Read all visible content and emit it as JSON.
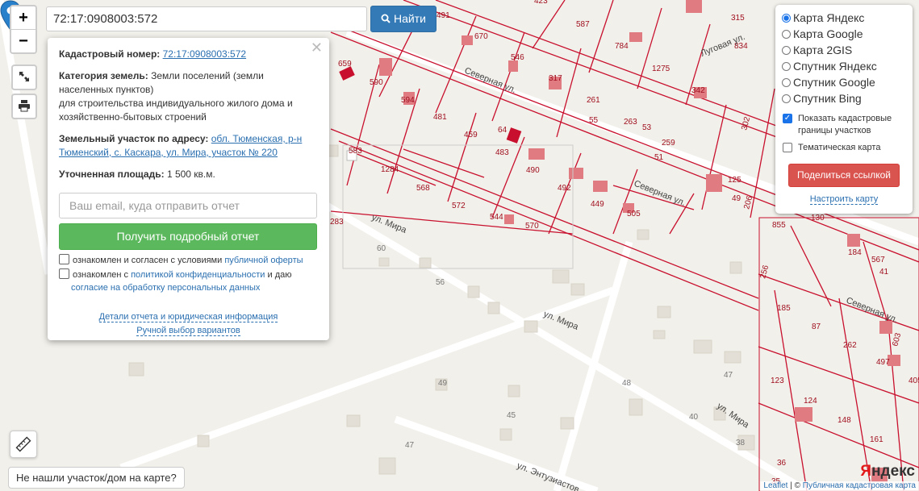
{
  "search": {
    "value": "72:17:0908003:572",
    "button_label": "Найти"
  },
  "zoom": {
    "in_label": "+",
    "out_label": "−"
  },
  "popup": {
    "cadastral_label": "Кадастровый номер:",
    "cadastral_number": "72:17:0908003:572",
    "category_label": "Категория земель:",
    "category_value": "Земли поселений (земли населенных пунктов)",
    "use_value": "для строительства индивидуального жилого дома и хозяйственно-бытовых строений",
    "address_label": "Земельный участок по адресу:",
    "address_value": "обл. Тюменская, р-н Тюменский, с. Каскара, ул. Мира, участок № 220",
    "area_label": "Уточненная площадь:",
    "area_value": "1 500 кв.м.",
    "email_placeholder": "Ваш email, куда отправить отчет",
    "report_button": "Получить подробный отчет",
    "consent1_text": "ознакомлен и согласен с условиями",
    "consent1_link": "публичной оферты",
    "consent2_text": "ознакомлен с",
    "consent2_link": "политикой конфиденциальности",
    "consent2_mid": "и даю",
    "consent2_link2": "согласие на обработку персональных данных",
    "details_link": "Детали отчета и юридическая информация",
    "manual_link": "Ручной выбор вариантов"
  },
  "layers": {
    "options": [
      {
        "label": "Карта Яндекс",
        "selected": true
      },
      {
        "label": "Карта Google",
        "selected": false
      },
      {
        "label": "Карта 2GIS",
        "selected": false
      },
      {
        "label": "Спутник Яндекс",
        "selected": false
      },
      {
        "label": "Спутник Google",
        "selected": false
      },
      {
        "label": "Спутник Bing",
        "selected": false
      }
    ],
    "show_cadastral_label": "Показать кадастровые границы участков",
    "show_cadastral_checked": true,
    "thematic_label": "Тематическая карта",
    "thematic_checked": false,
    "share_button": "Поделиться ссылкой",
    "configure_link": "Настроить карту"
  },
  "not_found_label": "Не нашли участок/дом на карте?",
  "attribution": {
    "leaflet": "Leaflet",
    "sep": " | © ",
    "pkk": "Публичная кадастровая карта"
  },
  "yandex_logo": {
    "first": "Я",
    "rest": "ндекс"
  },
  "map": {
    "parcel_labels": [
      "491",
      "423",
      "587",
      "315",
      "834",
      "670",
      "784",
      "546",
      "1275",
      "659",
      "590",
      "317",
      "342",
      "594",
      "481",
      "261",
      "459",
      "64",
      "55",
      "263",
      "53",
      "483",
      "259",
      "51",
      "1284",
      "583",
      "490",
      "125",
      "568",
      "572",
      "492",
      "449",
      "505",
      "544",
      "570",
      "283",
      "302",
      "206",
      "855",
      "130",
      "184",
      "567",
      "41",
      "49",
      "256",
      "185",
      "87",
      "262",
      "497",
      "603",
      "123",
      "124",
      "148",
      "161",
      "405",
      "36",
      "35"
    ],
    "house_labels": [
      "60",
      "56",
      "49",
      "48",
      "47",
      "45",
      "40",
      "38",
      "47"
    ],
    "street_labels": [
      "Северная ул.",
      "Луговая ул.",
      "Северная ул.",
      "ул. Мира",
      "ул. Мира",
      "ул. Мира",
      "ул. Энтузиастов",
      "Северная ул."
    ],
    "colors": {
      "parcel": "#c8102e",
      "road": "#ffffff",
      "ground": "#f2f0ea",
      "building": "#e8e4dc"
    }
  }
}
